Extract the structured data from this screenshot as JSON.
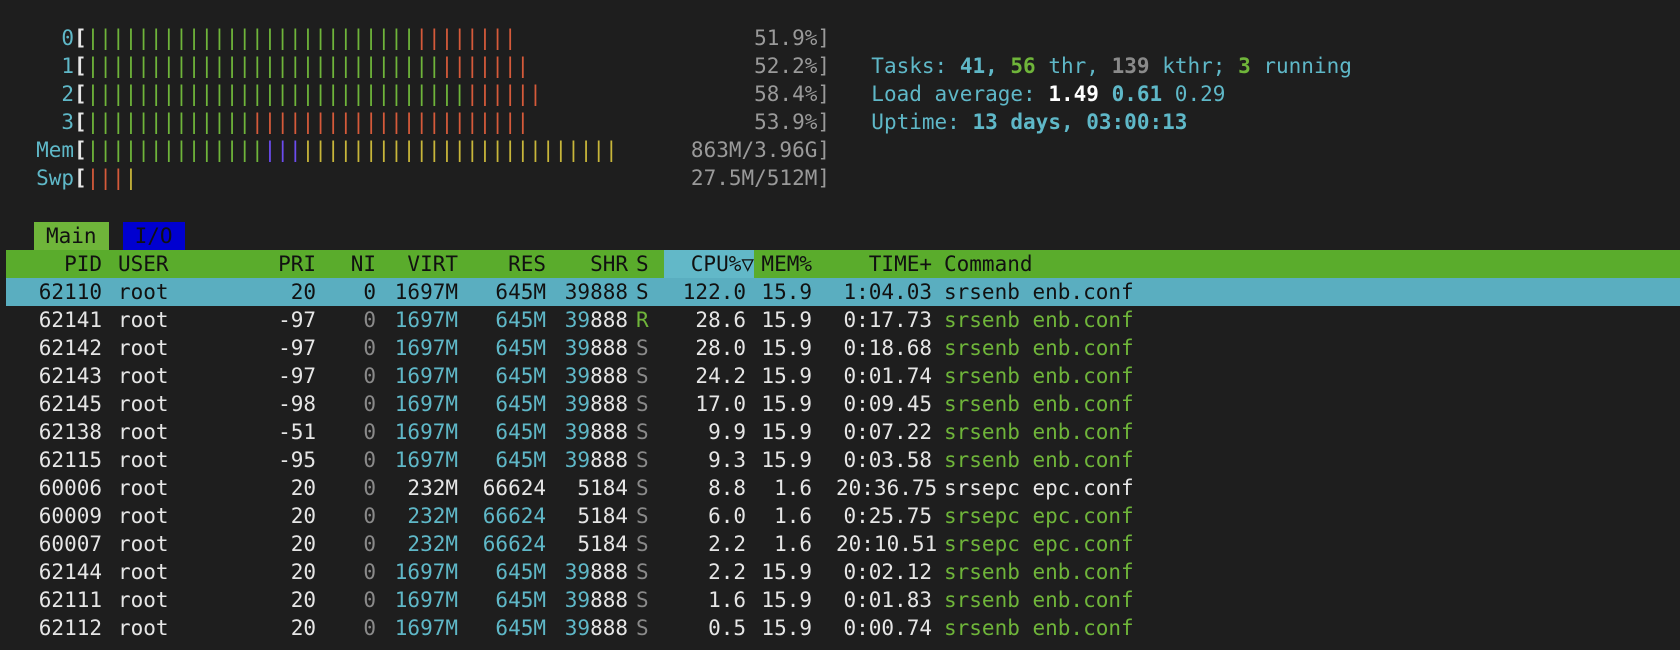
{
  "meters": {
    "cpus": [
      {
        "label": "0",
        "green": 26,
        "red": 8,
        "value": "51.9%]"
      },
      {
        "label": "1",
        "green": 28,
        "red": 7,
        "value": "52.2%]"
      },
      {
        "label": "2",
        "green": 30,
        "red": 6,
        "value": "58.4%]"
      },
      {
        "label": "3",
        "green": 13,
        "red": 22,
        "value": "53.9%]"
      }
    ],
    "mem": {
      "label": "Mem",
      "value": "863M/3.96G]",
      "green": 14,
      "blue": 3,
      "yellow": 25
    },
    "swp": {
      "label": "Swp",
      "value": "27.5M/512M]",
      "red": 3,
      "yellow": 1
    }
  },
  "summary": {
    "tasks_label": "Tasks:",
    "tasks_count": "41,",
    "thr_count": "56",
    "thr_label": "thr,",
    "kthr_count": "139",
    "kthr_label": "kthr;",
    "running_count": "3",
    "running_label": "running",
    "load_label": "Load average:",
    "load1": "1.49",
    "load5": "0.61",
    "load15": "0.29",
    "uptime_label": "Uptime:",
    "uptime_value": "13 days, 03:00:13"
  },
  "tabs": {
    "main": "Main",
    "io": "I/O"
  },
  "columns": {
    "pid": "PID",
    "user": "USER",
    "pri": "PRI",
    "ni": "NI",
    "virt": "VIRT",
    "res": "RES",
    "shr": "SHR",
    "s": "S",
    "cpu": "CPU%▽",
    "mem": "MEM%",
    "time": "TIME+",
    "command": "Command"
  },
  "processes": [
    {
      "pid": "62110",
      "user": "root",
      "pri": "20",
      "ni": "0",
      "virt": "1697M",
      "res": "645M",
      "shr_a": "39",
      "shr_b": "888",
      "s": "S",
      "cpu": "122.0",
      "mem": "15.9",
      "time": "1:04.03",
      "cmd": "srsenb enb.conf",
      "thread": false
    },
    {
      "pid": "62141",
      "user": "root",
      "pri": "-97",
      "ni": "0",
      "virt": "1697M",
      "res": "645M",
      "shr_a": "39",
      "shr_b": "888",
      "s": "R",
      "cpu": "28.6",
      "mem": "15.9",
      "time": "0:17.73",
      "cmd": "srsenb enb.conf",
      "thread": true
    },
    {
      "pid": "62142",
      "user": "root",
      "pri": "-97",
      "ni": "0",
      "virt": "1697M",
      "res": "645M",
      "shr_a": "39",
      "shr_b": "888",
      "s": "S",
      "cpu": "28.0",
      "mem": "15.9",
      "time": "0:18.68",
      "cmd": "srsenb enb.conf",
      "thread": true
    },
    {
      "pid": "62143",
      "user": "root",
      "pri": "-97",
      "ni": "0",
      "virt": "1697M",
      "res": "645M",
      "shr_a": "39",
      "shr_b": "888",
      "s": "S",
      "cpu": "24.2",
      "mem": "15.9",
      "time": "0:01.74",
      "cmd": "srsenb enb.conf",
      "thread": true
    },
    {
      "pid": "62145",
      "user": "root",
      "pri": "-98",
      "ni": "0",
      "virt": "1697M",
      "res": "645M",
      "shr_a": "39",
      "shr_b": "888",
      "s": "S",
      "cpu": "17.0",
      "mem": "15.9",
      "time": "0:09.45",
      "cmd": "srsenb enb.conf",
      "thread": true
    },
    {
      "pid": "62138",
      "user": "root",
      "pri": "-51",
      "ni": "0",
      "virt": "1697M",
      "res": "645M",
      "shr_a": "39",
      "shr_b": "888",
      "s": "S",
      "cpu": "9.9",
      "mem": "15.9",
      "time": "0:07.22",
      "cmd": "srsenb enb.conf",
      "thread": true
    },
    {
      "pid": "62115",
      "user": "root",
      "pri": "-95",
      "ni": "0",
      "virt": "1697M",
      "res": "645M",
      "shr_a": "39",
      "shr_b": "888",
      "s": "S",
      "cpu": "9.3",
      "mem": "15.9",
      "time": "0:03.58",
      "cmd": "srsenb enb.conf",
      "thread": true
    },
    {
      "pid": "60006",
      "user": "root",
      "pri": "20",
      "ni": "0",
      "virt": "232M",
      "res": "66624",
      "shr_a": "",
      "shr_b": "5184",
      "s": "S",
      "cpu": "8.8",
      "mem": "1.6",
      "time": "20:36.75",
      "cmd": "srsepc epc.conf",
      "thread": false
    },
    {
      "pid": "60009",
      "user": "root",
      "pri": "20",
      "ni": "0",
      "virt": "232M",
      "res": "66624",
      "shr_a": "",
      "shr_b": "5184",
      "s": "S",
      "cpu": "6.0",
      "mem": "1.6",
      "time": "0:25.75",
      "cmd": "srsepc epc.conf",
      "thread": true
    },
    {
      "pid": "60007",
      "user": "root",
      "pri": "20",
      "ni": "0",
      "virt": "232M",
      "res": "66624",
      "shr_a": "",
      "shr_b": "5184",
      "s": "S",
      "cpu": "2.2",
      "mem": "1.6",
      "time": "20:10.51",
      "cmd": "srsepc epc.conf",
      "thread": true
    },
    {
      "pid": "62144",
      "user": "root",
      "pri": "20",
      "ni": "0",
      "virt": "1697M",
      "res": "645M",
      "shr_a": "39",
      "shr_b": "888",
      "s": "S",
      "cpu": "2.2",
      "mem": "15.9",
      "time": "0:02.12",
      "cmd": "srsenb enb.conf",
      "thread": true
    },
    {
      "pid": "62111",
      "user": "root",
      "pri": "20",
      "ni": "0",
      "virt": "1697M",
      "res": "645M",
      "shr_a": "39",
      "shr_b": "888",
      "s": "S",
      "cpu": "1.6",
      "mem": "15.9",
      "time": "0:01.83",
      "cmd": "srsenb enb.conf",
      "thread": true
    },
    {
      "pid": "62112",
      "user": "root",
      "pri": "20",
      "ni": "0",
      "virt": "1697M",
      "res": "645M",
      "shr_a": "39",
      "shr_b": "888",
      "s": "S",
      "cpu": "0.5",
      "mem": "15.9",
      "time": "0:00.74",
      "cmd": "srsenb enb.conf",
      "thread": true
    }
  ],
  "colors": {
    "background": "#1e1e1e",
    "header": "#5aac2c",
    "selected_row": "#5aaec0",
    "tab_main": "#6fb53a",
    "tab_io": "#0000d0",
    "cyan": "#5fb8c8",
    "green": "#6fb53a",
    "red": "#d65a3a"
  }
}
